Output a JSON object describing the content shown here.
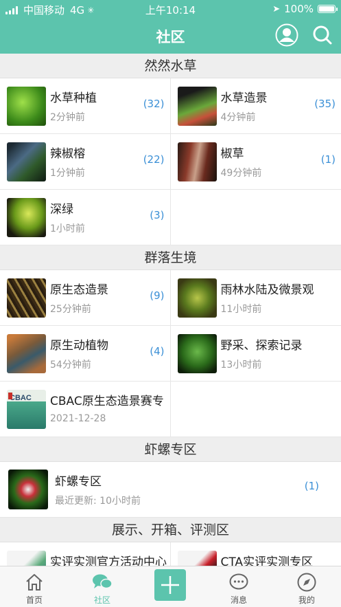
{
  "status_bar": {
    "carrier": "中国移动",
    "network": "4G",
    "time": "上午10:14",
    "battery": "100%"
  },
  "nav": {
    "title": "社区"
  },
  "sections": [
    {
      "title": "然然水草",
      "items": [
        {
          "name": "水草种植",
          "time": "2分钟前",
          "count": "(32)"
        },
        {
          "name": "水草造景",
          "time": "4分钟前",
          "count": "(35)"
        },
        {
          "name": "辣椒榕",
          "time": "1分钟前",
          "count": "(22)"
        },
        {
          "name": "椒草",
          "time": "49分钟前",
          "count": "(1)"
        },
        {
          "name": "深绿",
          "time": "1小时前",
          "count": "(3)"
        }
      ]
    },
    {
      "title": "群落生境",
      "items": [
        {
          "name": "原生态造景",
          "time": "25分钟前",
          "count": "(9)"
        },
        {
          "name": "雨林水陆及微景观",
          "time": "11小时前",
          "count": ""
        },
        {
          "name": "原生动植物",
          "time": "54分钟前",
          "count": "(4)"
        },
        {
          "name": "野采、探索记录",
          "time": "13小时前",
          "count": ""
        },
        {
          "name": "CBAC原生态造景赛专",
          "time": "2021-12-28",
          "count": "",
          "thumb_text": "CBAC"
        }
      ]
    },
    {
      "title": "虾螺专区",
      "items": [
        {
          "name": "虾螺专区",
          "time": "最近更新: 10小时前",
          "count": "(1)"
        }
      ]
    },
    {
      "title": "展示、开箱、评测区",
      "items": [
        {
          "name": "实评实测官方活动中心",
          "time": "",
          "count": ""
        },
        {
          "name": "CTA实评实测专区",
          "time": "",
          "count": ""
        }
      ]
    }
  ],
  "tabs": [
    {
      "label": "首页",
      "icon": "home-icon"
    },
    {
      "label": "社区",
      "icon": "chat-bubbles-icon"
    },
    {
      "label": "",
      "icon": "plus-icon"
    },
    {
      "label": "消息",
      "icon": "message-icon"
    },
    {
      "label": "我的",
      "icon": "compass-icon"
    }
  ],
  "colors": {
    "accent": "#5cc4ad",
    "count": "#3a8fd6"
  }
}
